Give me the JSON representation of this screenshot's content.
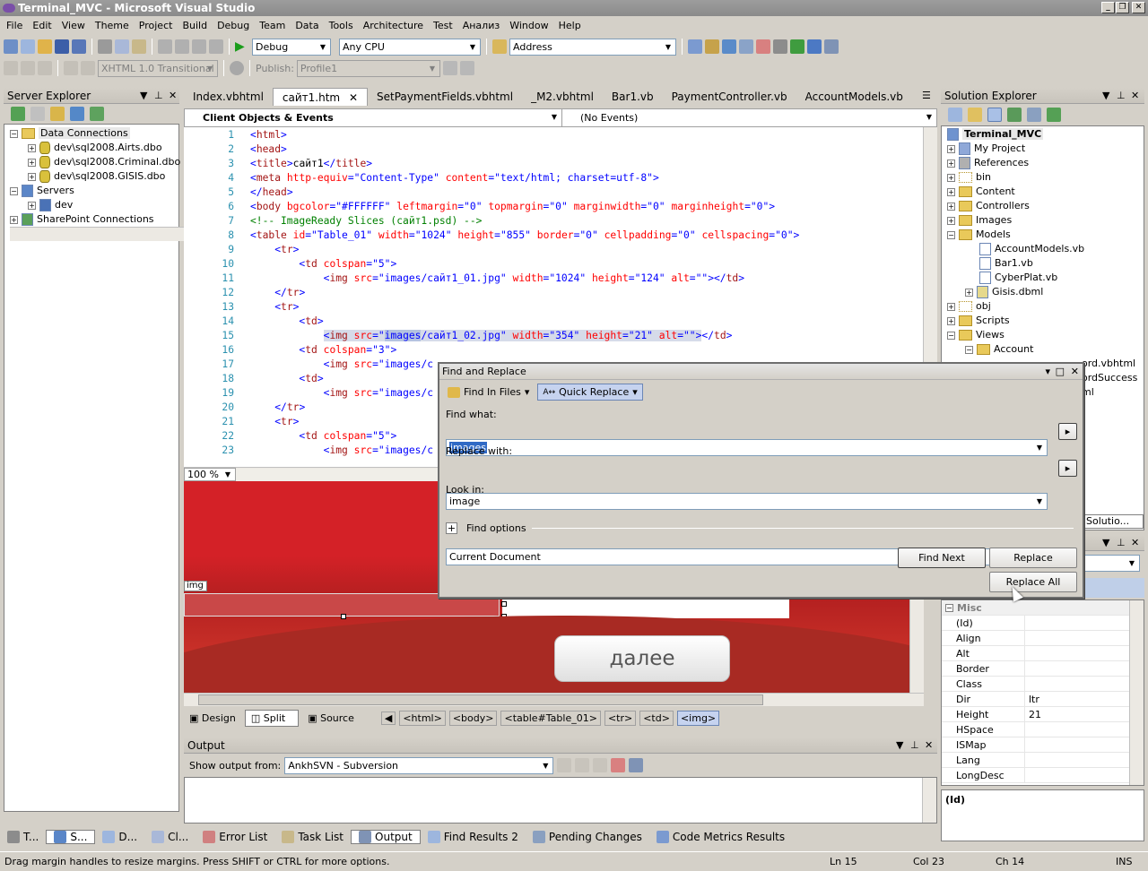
{
  "window": {
    "title": "Terminal_MVC - Microsoft Visual Studio"
  },
  "menu": [
    "File",
    "Edit",
    "View",
    "Theme",
    "Project",
    "Build",
    "Debug",
    "Team",
    "Data",
    "Tools",
    "Architecture",
    "Test",
    "Анализ",
    "Window",
    "Help"
  ],
  "toolbar1": {
    "config": "Debug",
    "platform": "Any CPU",
    "address": "Address"
  },
  "toolbar2": {
    "schema": "XHTML 1.0 Transitional",
    "publish_label": "Publish:",
    "profile": "Profile1"
  },
  "server_explorer": {
    "title": "Server Explorer",
    "items": [
      {
        "label": "Data Connections",
        "level": 0
      },
      {
        "label": "dev\\sql2008.Airts.dbo",
        "level": 1
      },
      {
        "label": "dev\\sql2008.Criminal.dbo",
        "level": 1
      },
      {
        "label": "dev\\sql2008.GISIS.dbo",
        "level": 1
      },
      {
        "label": "Servers",
        "level": 0
      },
      {
        "label": "dev",
        "level": 1
      },
      {
        "label": "SharePoint Connections",
        "level": 0
      }
    ]
  },
  "doc_tabs": [
    "Index.vbhtml",
    "сайт1.htm",
    "SetPaymentFields.vbhtml",
    "_M2.vbhtml",
    "Bar1.vb",
    "PaymentController.vb",
    "AccountModels.vb"
  ],
  "editor": {
    "objects_combo": "Client Objects & Events",
    "events_combo": "(No Events)",
    "zoom": "100 %",
    "lines": [
      "1",
      "2",
      "3",
      "4",
      "5",
      "6",
      "7",
      "8",
      "9",
      "10",
      "11",
      "12",
      "13",
      "14",
      "15",
      "16",
      "17",
      "18",
      "19",
      "20",
      "21",
      "22",
      "23"
    ]
  },
  "design": {
    "tag_label": "img",
    "next_button": "далее"
  },
  "view_tabs": {
    "design": "Design",
    "split": "Split",
    "source": "Source"
  },
  "tag_path": [
    "<html>",
    "<body>",
    "<table#Table_01>",
    "<tr>",
    "<td>",
    "<img>"
  ],
  "find_dialog": {
    "title": "Find and Replace",
    "tab_find_in_files": "Find In Files",
    "tab_quick_replace": "Quick Replace",
    "find_label": "Find what:",
    "find_value": "images",
    "replace_label": "Replace with:",
    "replace_value": "image",
    "look_in_label": "Look in:",
    "look_in_value": "Current Document",
    "find_options": "Find options",
    "find_next": "Find Next",
    "replace": "Replace",
    "replace_all": "Replace All"
  },
  "solution_explorer": {
    "title": "Solution Explorer",
    "items": [
      {
        "label": "Terminal_MVC",
        "type": "project"
      },
      {
        "label": "My Project",
        "type": "special"
      },
      {
        "label": "References",
        "type": "special"
      },
      {
        "label": "bin",
        "type": "folder"
      },
      {
        "label": "Content",
        "type": "folder"
      },
      {
        "label": "Controllers",
        "type": "folder"
      },
      {
        "label": "Images",
        "type": "folder"
      },
      {
        "label": "Models",
        "type": "folder"
      },
      {
        "label": "AccountModels.vb",
        "type": "file"
      },
      {
        "label": "Bar1.vb",
        "type": "file"
      },
      {
        "label": "CyberPlat.vb",
        "type": "file"
      },
      {
        "label": "Gisis.dbml",
        "type": "file"
      },
      {
        "label": "obj",
        "type": "folder"
      },
      {
        "label": "Scripts",
        "type": "folder"
      },
      {
        "label": "Views",
        "type": "folder"
      },
      {
        "label": "Account",
        "type": "folder"
      }
    ],
    "partial": [
      "ord.vbhtml",
      "ordSuccess",
      "ml"
    ],
    "tab_label": "Solutio..."
  },
  "properties": {
    "category": "Misc",
    "rows": [
      {
        "k": "(Id)",
        "v": ""
      },
      {
        "k": "Align",
        "v": ""
      },
      {
        "k": "Alt",
        "v": ""
      },
      {
        "k": "Border",
        "v": ""
      },
      {
        "k": "Class",
        "v": ""
      },
      {
        "k": "Dir",
        "v": "ltr"
      },
      {
        "k": "Height",
        "v": "21"
      },
      {
        "k": "HSpace",
        "v": ""
      },
      {
        "k": "ISMap",
        "v": ""
      },
      {
        "k": "Lang",
        "v": ""
      },
      {
        "k": "LongDesc",
        "v": ""
      }
    ],
    "desc_title": "(Id)"
  },
  "output": {
    "title": "Output",
    "show_label": "Show output from:",
    "source": "AnkhSVN - Subversion"
  },
  "bottom_tabs": [
    "T...",
    "S...",
    "D...",
    "Cl...",
    "Error List",
    "Task List",
    "Output",
    "Find Results 2",
    "Pending Changes",
    "Code Metrics Results"
  ],
  "status": {
    "message": "Drag margin handles to resize margins. Press SHIFT or CTRL for more options.",
    "ln": "Ln 15",
    "col": "Col 23",
    "ch": "Ch 14",
    "mode": "INS"
  }
}
